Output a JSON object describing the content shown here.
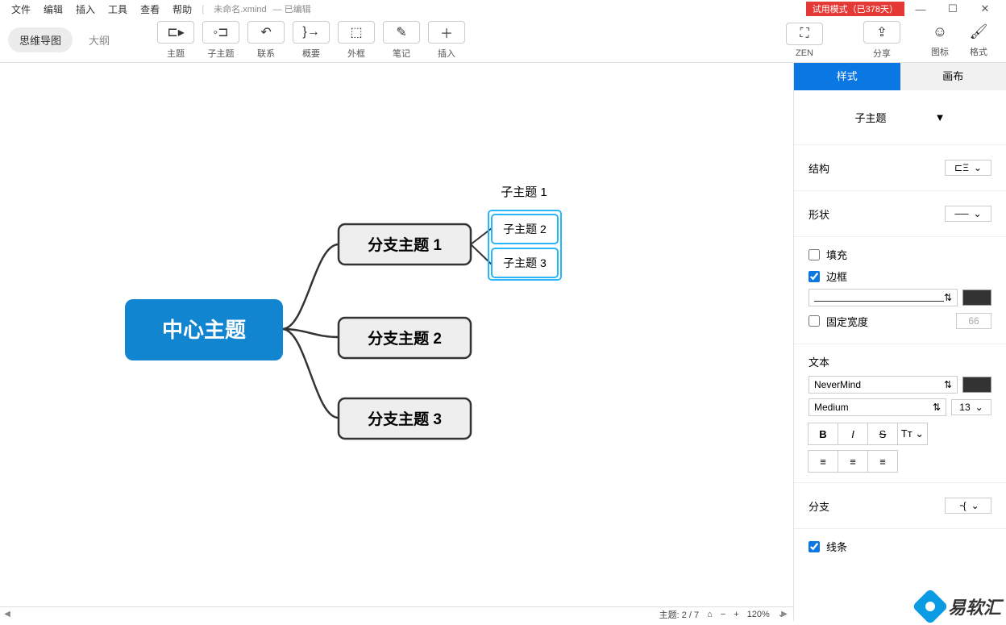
{
  "menu": {
    "file": "文件",
    "edit": "编辑",
    "insert": "插入",
    "tools": "工具",
    "view": "查看",
    "help": "帮助"
  },
  "fileinfo": {
    "name": "未命名.xmind",
    "status": " — 已编辑"
  },
  "trial": "试用模式（已378天）",
  "viewtabs": {
    "mindmap": "思维导图",
    "outline": "大纲"
  },
  "tools": {
    "topic": "主题",
    "subtopic": "子主题",
    "relation": "联系",
    "summary": "概要",
    "boundary": "外框",
    "note": "笔记",
    "insert": "插入",
    "zen": "ZEN",
    "share": "分享",
    "icons": "图标",
    "format": "格式"
  },
  "mindmap": {
    "center": "中心主题",
    "b1": "分支主题 1",
    "b2": "分支主题 2",
    "b3": "分支主题 3",
    "s1_float": "子主题 1",
    "s2": "子主题 2",
    "s3": "子主题 3"
  },
  "panel": {
    "tab_style": "样式",
    "tab_canvas": "画布",
    "element_type": "子主题",
    "structure": "结构",
    "shape": "形状",
    "fill": "填充",
    "border": "边框",
    "fixedwidth": "固定宽度",
    "fixedwidth_val": "66",
    "text": "文本",
    "font": "NeverMind",
    "weight": "Medium",
    "size": "13",
    "branch": "分支",
    "line": "线条"
  },
  "status": {
    "topics": "主题: 2 / 7",
    "zoom": "120%"
  }
}
